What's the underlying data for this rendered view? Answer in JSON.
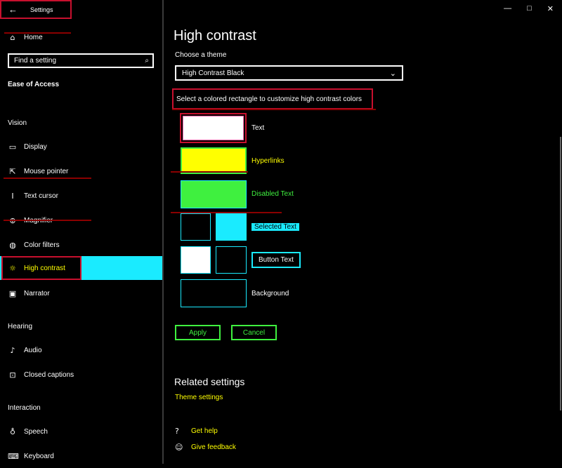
{
  "titlebar": {
    "back_icon": "arrow-left-icon",
    "title": "Settings",
    "minimize": "—",
    "maximize": "□",
    "close": "✕"
  },
  "sidebar": {
    "home_label": "Home",
    "search_placeholder": "Find a setting",
    "category_title": "Ease of Access",
    "sections": {
      "vision": "Vision",
      "hearing": "Hearing",
      "interaction": "Interaction"
    },
    "items": [
      {
        "label": "Display",
        "icon": "monitor-icon"
      },
      {
        "label": "Mouse pointer",
        "icon": "mouse-pointer-icon"
      },
      {
        "label": "Text cursor",
        "icon": "text-cursor-icon"
      },
      {
        "label": "Magnifier",
        "icon": "magnifier-icon"
      },
      {
        "label": "Color filters",
        "icon": "palette-icon"
      },
      {
        "label": "High contrast",
        "icon": "sun-icon"
      },
      {
        "label": "Narrator",
        "icon": "narrator-icon"
      },
      {
        "label": "Audio",
        "icon": "speaker-icon"
      },
      {
        "label": "Closed captions",
        "icon": "captions-icon"
      },
      {
        "label": "Speech",
        "icon": "microphone-icon"
      },
      {
        "label": "Keyboard",
        "icon": "keyboard-icon"
      }
    ]
  },
  "main": {
    "title": "High contrast",
    "theme_label": "Choose a theme",
    "theme_value": "High Contrast Black",
    "hint": "Select a colored rectangle to customize high contrast colors",
    "swatch_labels": {
      "text": "Text",
      "hyperlinks": "Hyperlinks",
      "disabled": "Disabled Text",
      "selected": "Selected Text",
      "button": "Button Text",
      "background": "Background"
    },
    "colors": {
      "text": "#ffffff",
      "hyperlinks": "#ffff00",
      "disabled": "#3ff03f",
      "selected_bg": "#1aebff",
      "button_face": "#000000",
      "background": "#000000",
      "accent_red": "#c8102e"
    },
    "apply_label": "Apply",
    "cancel_label": "Cancel",
    "related_title": "Related settings",
    "theme_settings_link": "Theme settings",
    "get_help": "Get help",
    "give_feedback": "Give feedback"
  }
}
